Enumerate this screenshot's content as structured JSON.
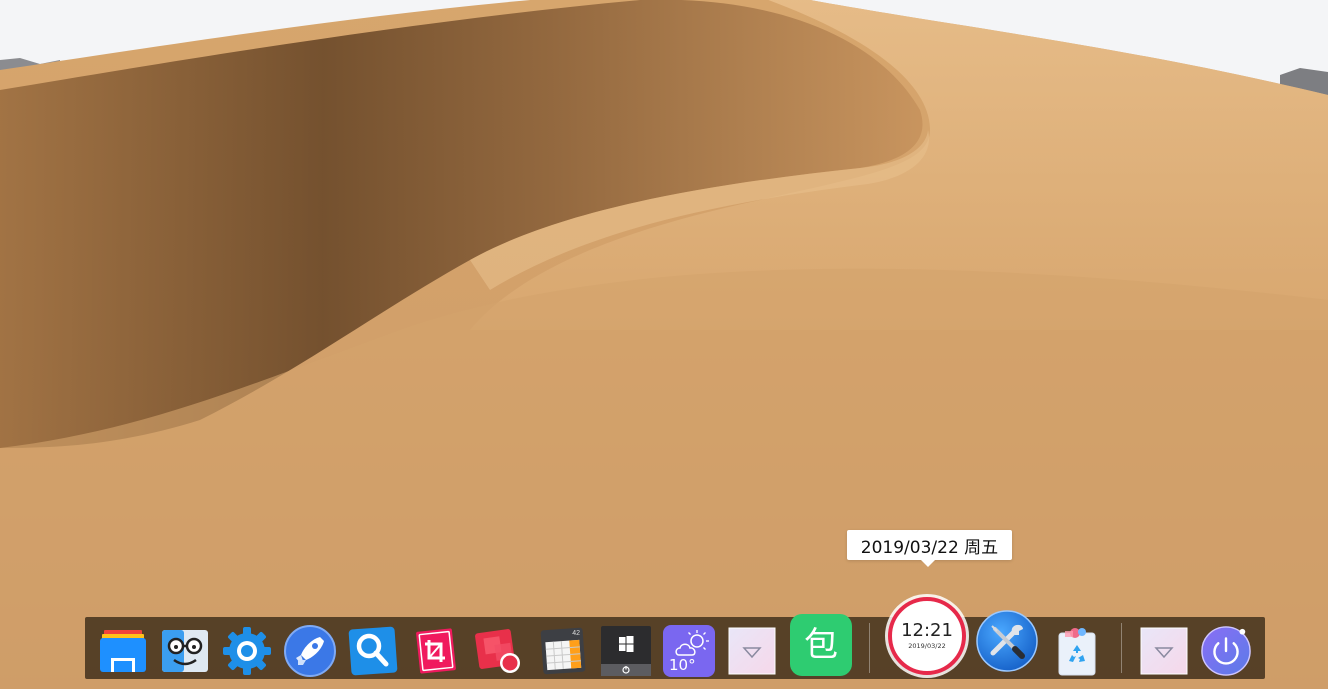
{
  "tooltip": {
    "text": "2019/03/22 周五"
  },
  "dock": {
    "items": [
      {
        "name": "file-explorer",
        "icon": "folder-icon"
      },
      {
        "name": "finder",
        "icon": "finder-face-icon"
      },
      {
        "name": "settings",
        "icon": "gear-icon"
      },
      {
        "name": "launchpad",
        "icon": "rocket-icon"
      },
      {
        "name": "search",
        "icon": "magnifier-icon"
      },
      {
        "name": "crop-tool",
        "icon": "crop-icon"
      },
      {
        "name": "screen-recorder",
        "icon": "record-icon"
      },
      {
        "name": "calculator",
        "icon": "calculator-icon",
        "display": "42"
      },
      {
        "name": "start-menu",
        "icon": "windows-logo-icon"
      },
      {
        "name": "weather",
        "icon": "cloud-sun-icon",
        "temperature": "10°"
      },
      {
        "name": "folder-stack",
        "icon": "dropdown-arrow-icon"
      },
      {
        "name": "bao-app",
        "icon": "bao-icon",
        "label": "包"
      },
      {
        "name": "clock",
        "icon": "clock-icon",
        "time": "12:21",
        "date": "2019/03/22"
      },
      {
        "name": "tools",
        "icon": "wrench-screwdriver-icon"
      },
      {
        "name": "recycle-bin",
        "icon": "recycle-icon"
      },
      {
        "name": "folder-stack-2",
        "icon": "dropdown-arrow-icon"
      },
      {
        "name": "power",
        "icon": "power-icon"
      }
    ]
  },
  "colors": {
    "dock_bg": "#3c2c18",
    "clock_ring": "#e6294a",
    "bao_green": "#2ecc71",
    "weather_purple": "#7a67f0",
    "settings_blue": "#1e8fe8"
  }
}
